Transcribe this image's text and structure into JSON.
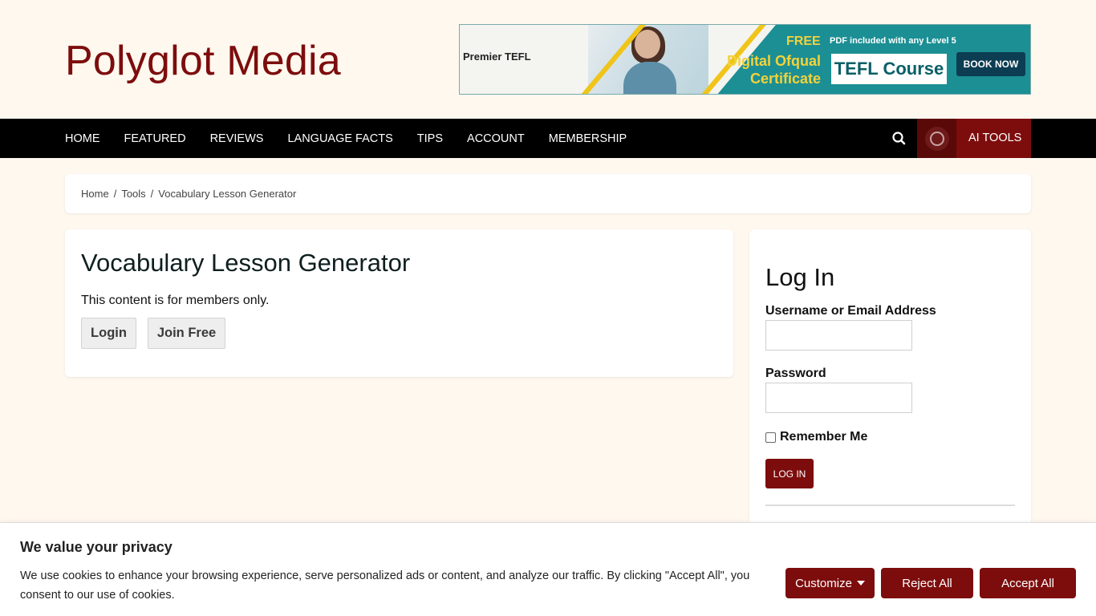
{
  "site": {
    "title": "Polyglot Media"
  },
  "banner": {
    "brand": "Premier TEFL",
    "free": "FREE",
    "pdf_text": "PDF included with any Level 5",
    "certificate_line1": "Digital Ofqual",
    "certificate_line2": "Certificate",
    "course": "TEFL Course",
    "cta": "BOOK NOW"
  },
  "nav": {
    "items": [
      "HOME",
      "FEATURED",
      "REVIEWS",
      "LANGUAGE FACTS",
      "TIPS",
      "ACCOUNT",
      "MEMBERSHIP"
    ],
    "search_icon": "search-icon",
    "ai_tools": "AI TOOLS"
  },
  "breadcrumb": {
    "home": "Home",
    "tools": "Tools",
    "current": "Vocabulary Lesson Generator",
    "separator": "/"
  },
  "main": {
    "title": "Vocabulary Lesson Generator",
    "message": "This content is for members only.",
    "login_label": "Login",
    "join_label": "Join Free"
  },
  "sidebar": {
    "login_title": "Log In",
    "username_label": "Username or Email Address",
    "password_label": "Password",
    "remember_label": "Remember Me",
    "submit_label": "LOG IN"
  },
  "cookie": {
    "title": "We value your privacy",
    "text": "We use cookies to enhance your browsing experience, serve personalized ads or content, and analyze our traffic. By clicking \"Accept All\", you consent to our use of cookies.",
    "customize_label": "Customize",
    "reject_label": "Reject All",
    "accept_label": "Accept All"
  },
  "colors": {
    "brand": "#7d0d0d",
    "background": "#fff8ef",
    "nav": "#000000"
  }
}
